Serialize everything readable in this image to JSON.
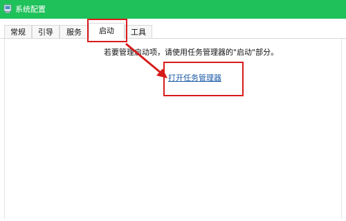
{
  "window": {
    "title": "系统配置",
    "icon": "msconfig-icon"
  },
  "tabs": [
    {
      "label": "常规",
      "active": false
    },
    {
      "label": "引导",
      "active": false
    },
    {
      "label": "服务",
      "active": false
    },
    {
      "label": "启动",
      "active": true
    },
    {
      "label": "工具",
      "active": false
    }
  ],
  "startup": {
    "description": "若要管理启动项，请使用任务管理器的\"启动\"部分。",
    "task_manager_link": "打开任务管理器"
  },
  "annotations": {
    "highlight_color": "#d71a1a",
    "arrow": "red-arrow"
  },
  "colors": {
    "titlebar": "#1fc15a",
    "link": "#1a5aa5"
  }
}
